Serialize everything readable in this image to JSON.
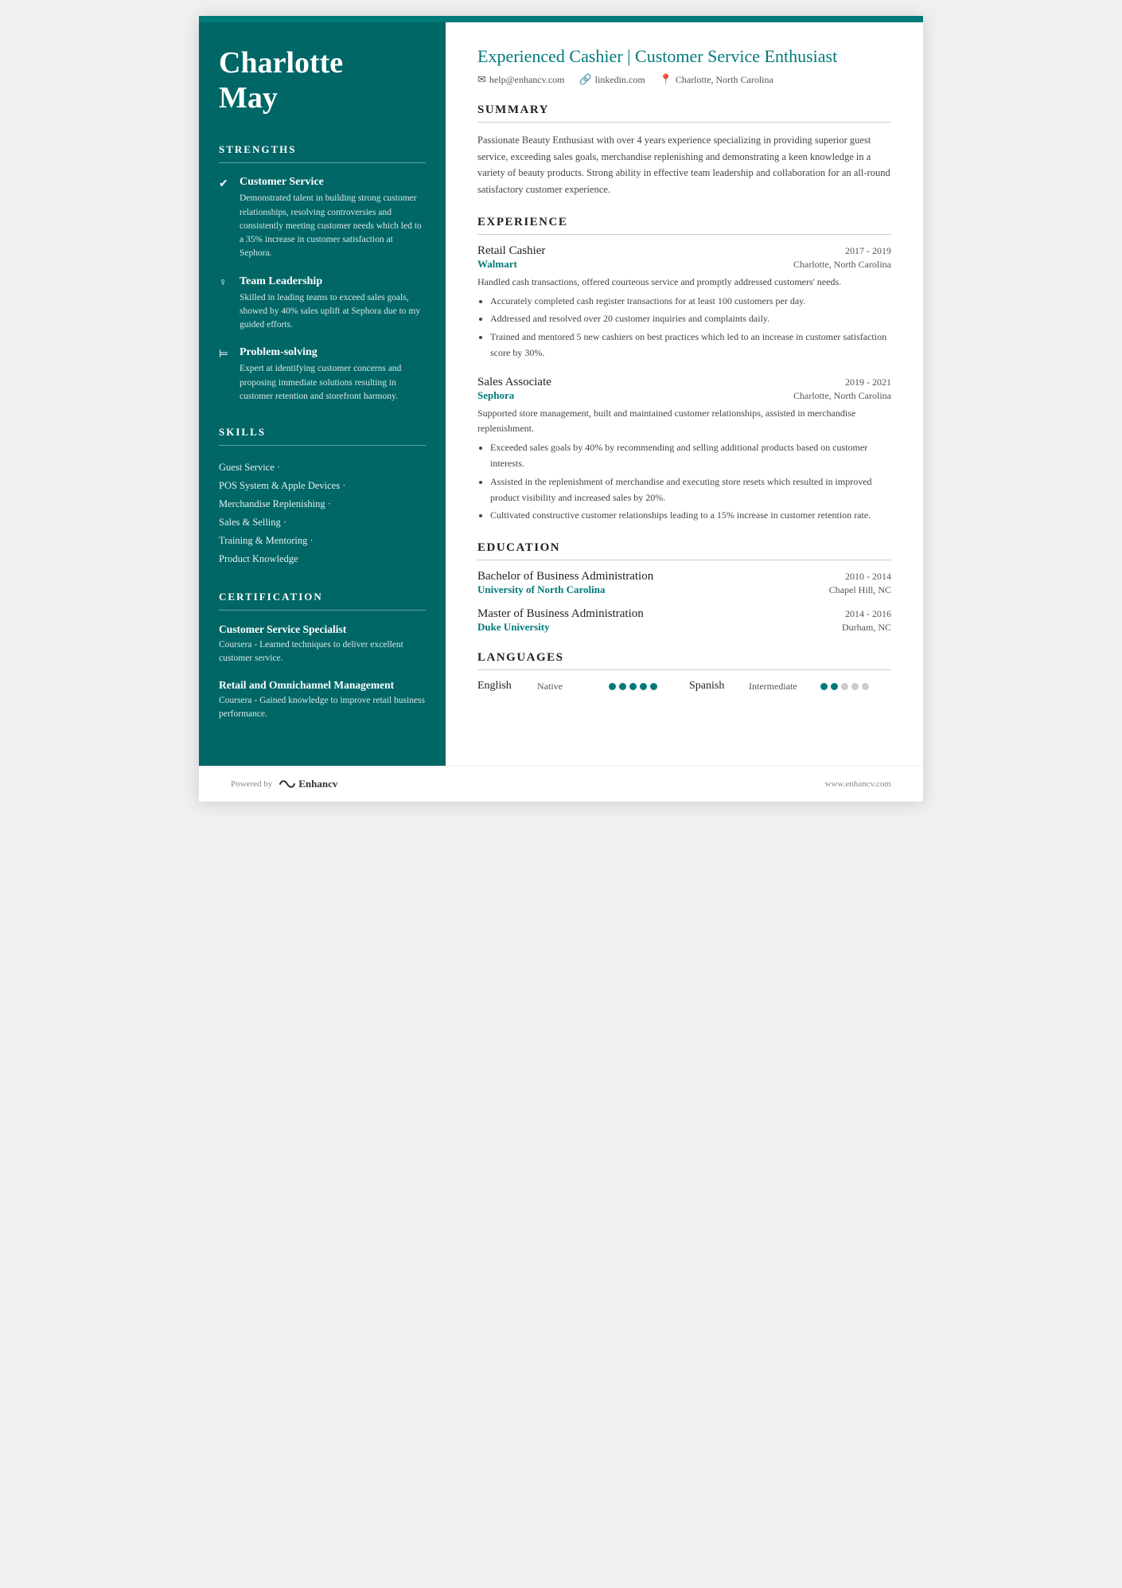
{
  "sidebar": {
    "name_line1": "Charlotte",
    "name_line2": "May",
    "strengths_title": "STRENGTHS",
    "strengths": [
      {
        "icon": "✔",
        "title": "Customer Service",
        "desc": "Demonstrated talent in building strong customer relationships, resolving controversies and consistently meeting customer needs which led to a 35% increase in customer satisfaction at Sephora."
      },
      {
        "icon": "♀",
        "title": "Team Leadership",
        "desc": "Skilled in leading teams to exceed sales goals, showed by 40% sales uplift at Sephora due to my guided efforts."
      },
      {
        "icon": "⊨",
        "title": "Problem-solving",
        "desc": "Expert at identifying customer concerns and proposing immediate solutions resulting in customer retention and storefront harmony."
      }
    ],
    "skills_title": "SKILLS",
    "skills": [
      "Guest Service ·",
      "POS System & Apple Devices ·",
      "Merchandise Replenishing ·",
      "Sales & Selling ·",
      "Training & Mentoring ·",
      "Product Knowledge"
    ],
    "cert_title": "CERTIFICATION",
    "certs": [
      {
        "title": "Customer Service Specialist",
        "desc": "Coursera - Learned techniques to deliver excellent customer service."
      },
      {
        "title": "Retail and Omnichannel Management",
        "desc": "Coursera - Gained knowledge to improve retail business performance."
      }
    ]
  },
  "main": {
    "title": "Experienced Cashier | Customer Service Enthusiast",
    "contacts": [
      {
        "icon": "✉",
        "text": "help@enhancv.com"
      },
      {
        "icon": "🔗",
        "text": "linkedin.com"
      },
      {
        "icon": "📍",
        "text": "Charlotte, North Carolina"
      }
    ],
    "summary_title": "SUMMARY",
    "summary": "Passionate Beauty Enthusiast with over 4 years experience specializing in providing superior guest service, exceeding sales goals, merchandise replenishing and demonstrating a keen knowledge in a variety of beauty products. Strong ability in effective team leadership and collaboration for an all-round satisfactory customer experience.",
    "experience_title": "EXPERIENCE",
    "experiences": [
      {
        "title": "Retail Cashier",
        "dates": "2017 - 2019",
        "company": "Walmart",
        "location": "Charlotte, North Carolina",
        "desc": "Handled cash transactions, offered courteous service and promptly addressed customers' needs.",
        "bullets": [
          "Accurately completed cash register transactions for at least 100 customers per day.",
          "Addressed and resolved over 20 customer inquiries and complaints daily.",
          "Trained and mentored 5 new cashiers on best practices which led to an increase in customer satisfaction score by 30%."
        ]
      },
      {
        "title": "Sales Associate",
        "dates": "2019 - 2021",
        "company": "Sephora",
        "location": "Charlotte, North Carolina",
        "desc": "Supported store management, built and maintained customer relationships, assisted in merchandise replenishment.",
        "bullets": [
          "Exceeded sales goals by 40% by recommending and selling additional products based on customer interests.",
          "Assisted in the replenishment of merchandise and executing store resets which resulted in improved product visibility and increased sales by 20%.",
          "Cultivated constructive customer relationships leading to a 15% increase in customer retention rate."
        ]
      }
    ],
    "education_title": "EDUCATION",
    "education": [
      {
        "degree": "Bachelor of Business Administration",
        "dates": "2010 - 2014",
        "school": "University of North Carolina",
        "location": "Chapel Hill, NC"
      },
      {
        "degree": "Master of Business Administration",
        "dates": "2014 - 2016",
        "school": "Duke University",
        "location": "Durham, NC"
      }
    ],
    "languages_title": "LANGUAGES",
    "languages": [
      {
        "name": "English",
        "level": "Native",
        "filled": 5,
        "total": 5
      },
      {
        "name": "Spanish",
        "level": "Intermediate",
        "filled": 2,
        "total": 5
      }
    ]
  },
  "footer": {
    "powered_by": "Powered by",
    "brand": "Enhancv",
    "website": "www.enhancv.com"
  }
}
